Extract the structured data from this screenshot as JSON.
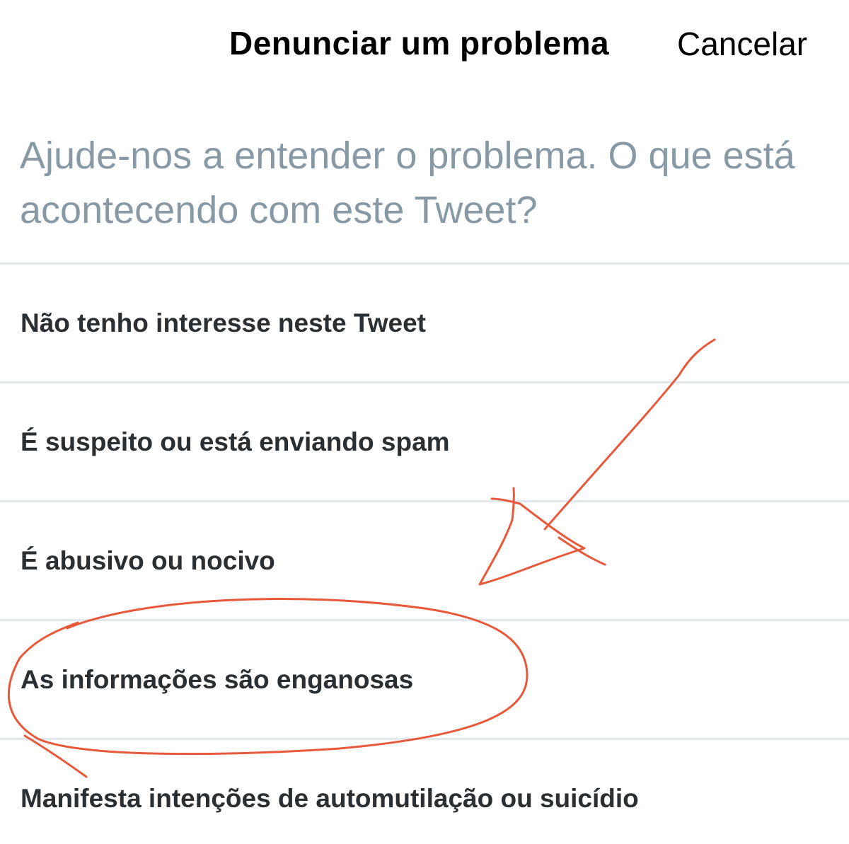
{
  "header": {
    "title": "Denunciar um problema",
    "cancel_label": "Cancelar"
  },
  "prompt": "Ajude-nos a entender o problema. O que está acontecendo com este Tweet?",
  "options": [
    {
      "label": "Não tenho interesse neste Tweet"
    },
    {
      "label": "É suspeito ou está enviando spam"
    },
    {
      "label": "É abusivo ou nocivo"
    },
    {
      "label": "As informações são enganosas"
    },
    {
      "label": "Manifesta intenções de automutilação ou suicídio"
    }
  ],
  "colors": {
    "prompt_text": "#8899a6",
    "divider": "#e1e8ed",
    "annotation": "#e8583a"
  }
}
